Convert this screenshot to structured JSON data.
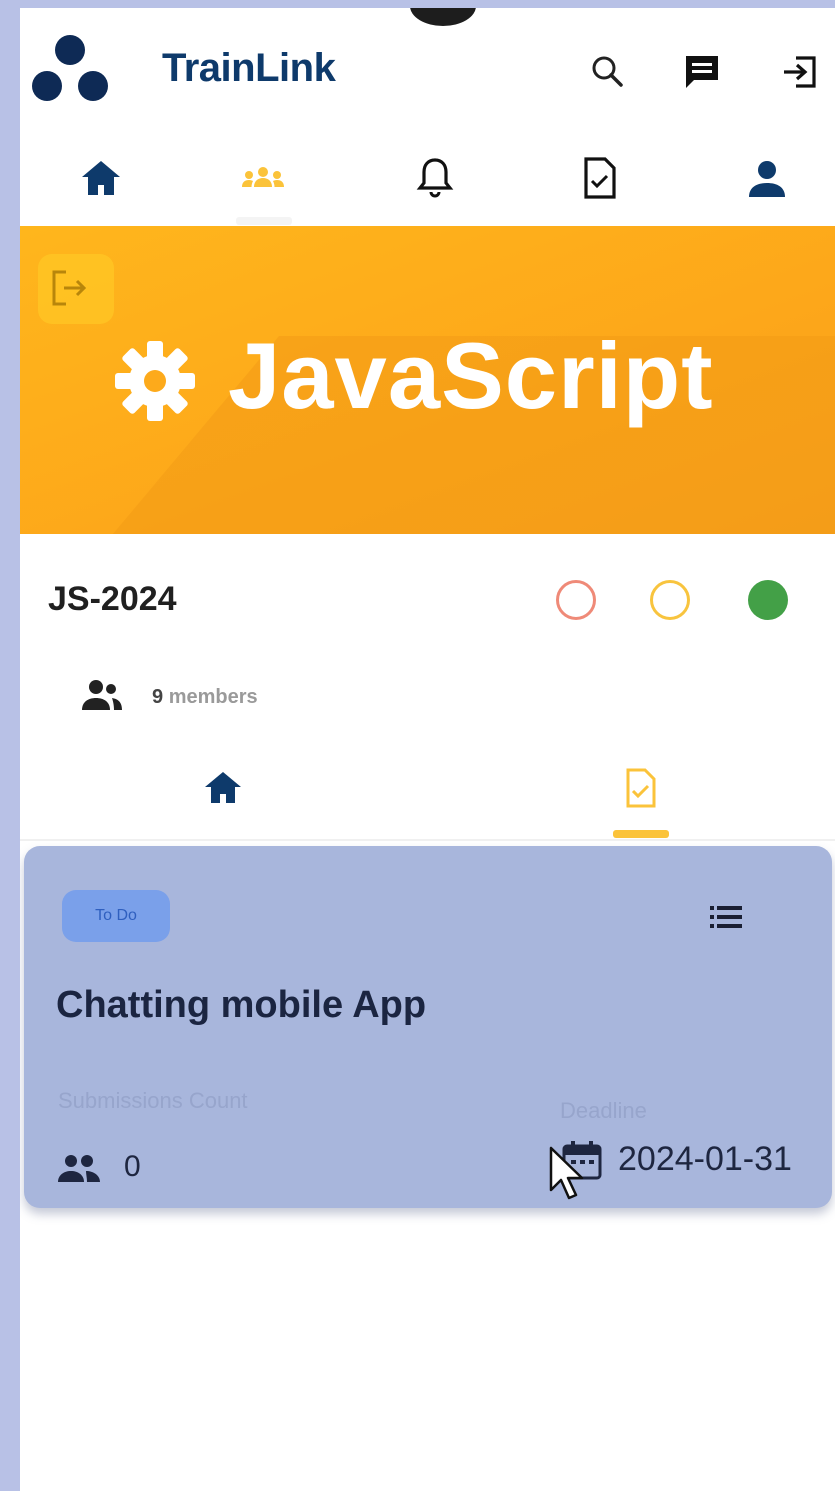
{
  "app": {
    "title": "TrainLink"
  },
  "header_icons": [
    "search-icon",
    "chat-icon",
    "logout-icon"
  ],
  "main_tabs": [
    "home-icon",
    "groups-icon",
    "notifications-icon",
    "tasks-icon",
    "profile-icon"
  ],
  "banner": {
    "title": "JavaScript"
  },
  "group": {
    "code": "JS-2024",
    "members_count": "9",
    "members_label": "members",
    "status_colors": [
      "#ef8a78",
      "#f8c43e",
      "#43a047"
    ]
  },
  "sub_tabs": [
    "home-icon",
    "tasks-icon"
  ],
  "task": {
    "status": "To Do",
    "title": "Chatting mobile App",
    "submissions_label": "Submissions Count",
    "submissions_count": "0",
    "deadline_label": "Deadline",
    "deadline": "2024-01-31"
  },
  "colors": {
    "brand": "#0e3a6b",
    "accent": "#fbc33a",
    "banner": "#fdaa1b",
    "card": "#a8b6dc"
  }
}
